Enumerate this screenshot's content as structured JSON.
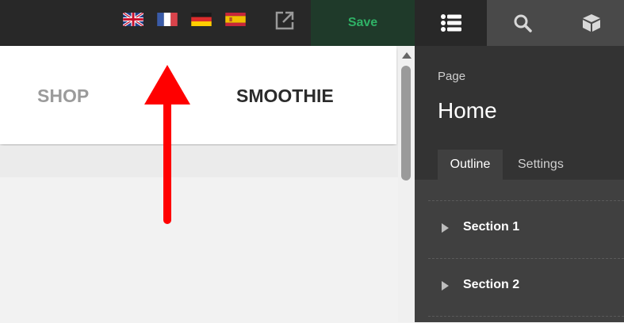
{
  "toolbar": {
    "languages": [
      "english-uk-flag",
      "french-flag",
      "german-flag",
      "spanish-flag"
    ],
    "external_icon": "external-link-icon",
    "save_label": "Save",
    "save_color": "#2fb266"
  },
  "panel": {
    "tabs": [
      "outline-list-icon",
      "search-icon",
      "cube-icon"
    ],
    "label": "Page",
    "title": "Home",
    "subtabs": {
      "active": "Outline",
      "inactive": "Settings"
    },
    "sections": [
      {
        "label": "Section 1"
      },
      {
        "label": "Section 2"
      }
    ]
  },
  "preview": {
    "nav": {
      "shop": "SHOP",
      "smoothie": "SMOOTHIE"
    },
    "annotation": {
      "type": "red-arrow-up",
      "color": "#ff0000"
    }
  }
}
